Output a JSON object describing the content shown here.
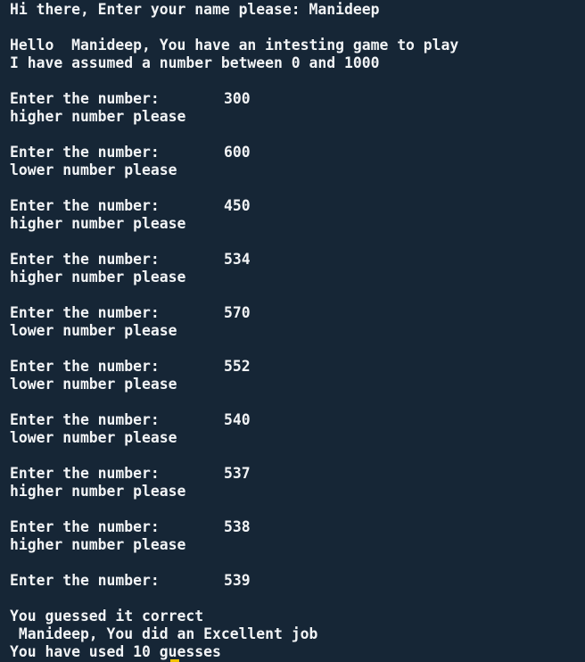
{
  "terminal": {
    "greeting": "Hi there, Enter your name please: Manideep",
    "hello": "Hello  Manideep, You have an intesting game to play",
    "assumed": "I have assumed a number between 0 and 1000",
    "prompt_label": "Enter the number:",
    "guesses": [
      {
        "value": "300",
        "hint": "higher number please"
      },
      {
        "value": "600",
        "hint": "lower number please"
      },
      {
        "value": "450",
        "hint": "higher number please"
      },
      {
        "value": "534",
        "hint": "higher number please"
      },
      {
        "value": "570",
        "hint": "lower number please"
      },
      {
        "value": "552",
        "hint": "lower number please"
      },
      {
        "value": "540",
        "hint": "lower number please"
      },
      {
        "value": "537",
        "hint": "higher number please"
      },
      {
        "value": "538",
        "hint": "higher number please"
      },
      {
        "value": "539",
        "hint": ""
      }
    ],
    "result_line1": "You guessed it correct",
    "result_line2": " Manideep, You did an Excellent job",
    "result_line3": "You have used 10 guesses"
  },
  "colors": {
    "background": "#162636",
    "text": "#f2f4f6",
    "cursor": "#f2c200"
  }
}
